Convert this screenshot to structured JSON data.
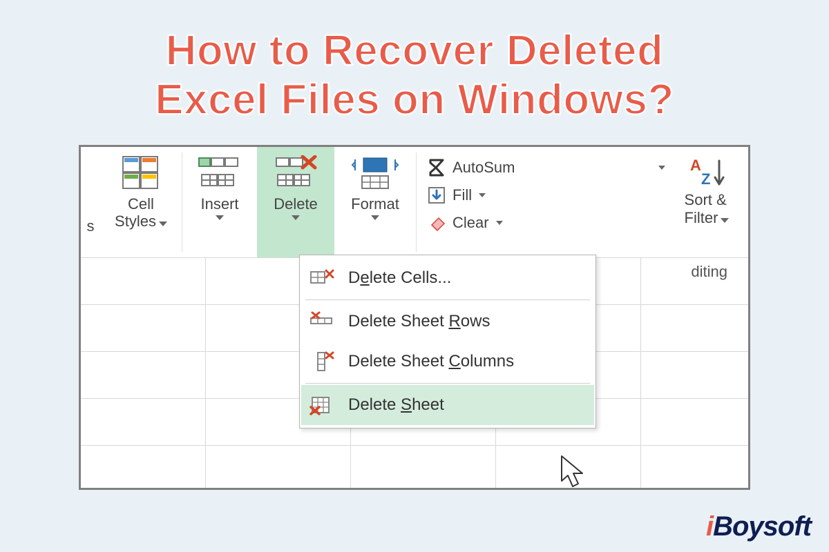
{
  "headline": {
    "line1": "How to Recover Deleted",
    "line2": "Excel Files on Windows?"
  },
  "ribbon": {
    "cut_suffix": "s",
    "cell_styles_l1": "Cell",
    "cell_styles_l2": "Styles",
    "insert": "Insert",
    "delete": "Delete",
    "format": "Format",
    "autosum": "AutoSum",
    "fill": "Fill",
    "clear": "Clear",
    "sort_l1": "Sort &",
    "sort_l2": "Filter",
    "editing_suffix": "diting"
  },
  "menu": {
    "cells_pre": "D",
    "cells_u": "e",
    "cells_post": "lete Cells...",
    "rows_pre": "Delete Sheet ",
    "rows_u": "R",
    "rows_post": "ows",
    "cols_pre": "Delete Sheet ",
    "cols_u": "C",
    "cols_post": "olumns",
    "sheet_pre": "Delete ",
    "sheet_u": "S",
    "sheet_post": "heet"
  },
  "brand": {
    "i": "i",
    "rest": "Boysoft"
  },
  "colors": {
    "accent": "#e85c4a",
    "highlight": "#c3e6cf",
    "menu_hover": "#d4ecdc"
  }
}
